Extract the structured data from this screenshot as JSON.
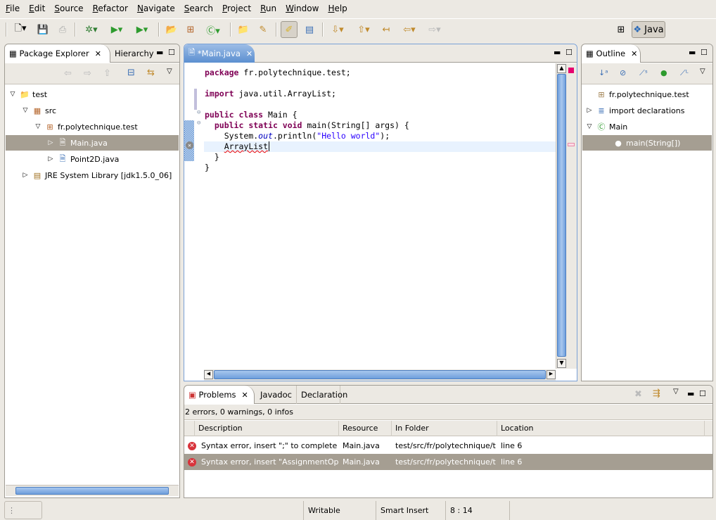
{
  "menu": [
    "File",
    "Edit",
    "Source",
    "Refactor",
    "Navigate",
    "Search",
    "Project",
    "Run",
    "Window",
    "Help"
  ],
  "perspective": {
    "label": "Java"
  },
  "package_explorer": {
    "tabs": [
      "Package Explorer",
      "Hierarchy"
    ],
    "tree": [
      {
        "label": "test",
        "level": 0,
        "expanded": true,
        "icon": "project-icon"
      },
      {
        "label": "src",
        "level": 1,
        "expanded": true,
        "icon": "source-folder-icon"
      },
      {
        "label": "fr.polytechnique.test",
        "level": 2,
        "expanded": true,
        "icon": "package-icon"
      },
      {
        "label": "Main.java",
        "level": 3,
        "expanded": false,
        "icon": "java-file-error-icon",
        "selected": true
      },
      {
        "label": "Point2D.java",
        "level": 3,
        "expanded": false,
        "icon": "java-file-icon"
      },
      {
        "label": "JRE System Library [jdk1.5.0_06]",
        "level": 1,
        "expanded": false,
        "icon": "library-icon"
      }
    ]
  },
  "editor": {
    "tab": "*Main.java",
    "lines": {
      "l1_kw": "package",
      "l1_rest": " fr.polytechnique.test;",
      "l3_kw": "import",
      "l3_rest": " java.util.ArrayList;",
      "l5_kw": "public class",
      "l5_rest": " Main {",
      "l6_kw": "public static void",
      "l6_rest": " main(String[] args) {",
      "l7_a": "    System.",
      "l7_out": "out",
      "l7_b": ".println(",
      "l7_str": "\"Hello world\"",
      "l7_c": ");",
      "l8_err": "ArrayList",
      "l9": "  }",
      "l10": "}"
    }
  },
  "outline": {
    "tab": "Outline",
    "items": [
      {
        "label": "fr.polytechnique.test",
        "level": 0,
        "icon": "package-decl-icon"
      },
      {
        "label": "import declarations",
        "level": 0,
        "icon": "imports-icon",
        "twisty": "closed"
      },
      {
        "label": "Main",
        "level": 0,
        "icon": "class-icon",
        "twisty": "open"
      },
      {
        "label": "main(String[])",
        "level": 1,
        "icon": "method-icon",
        "selected": true
      }
    ]
  },
  "problems": {
    "tabs": [
      "Problems",
      "Javadoc",
      "Declaration"
    ],
    "summary": "2 errors, 0 warnings, 0 infos",
    "columns": [
      "Description",
      "Resource",
      "In Folder",
      "Location"
    ],
    "rows": [
      {
        "description": "Syntax error, insert \";\" to complete Statement",
        "resource": "Main.java",
        "folder": "test/src/fr/polytechnique/test",
        "location": "line 6"
      },
      {
        "description": "Syntax error, insert \"AssignmentOperator Expression\"",
        "resource": "Main.java",
        "folder": "test/src/fr/polytechnique/test",
        "location": "line 6",
        "selected": true
      }
    ]
  },
  "status": {
    "writable": "Writable",
    "insert_mode": "Smart Insert",
    "position": "8 : 14"
  },
  "colors": {
    "keyword": "#7f0055",
    "string": "#2a00ff",
    "field": "#0000c0",
    "selection": "#a59e92",
    "active_tab": "#5b8fd0",
    "error": "#d8333b"
  }
}
